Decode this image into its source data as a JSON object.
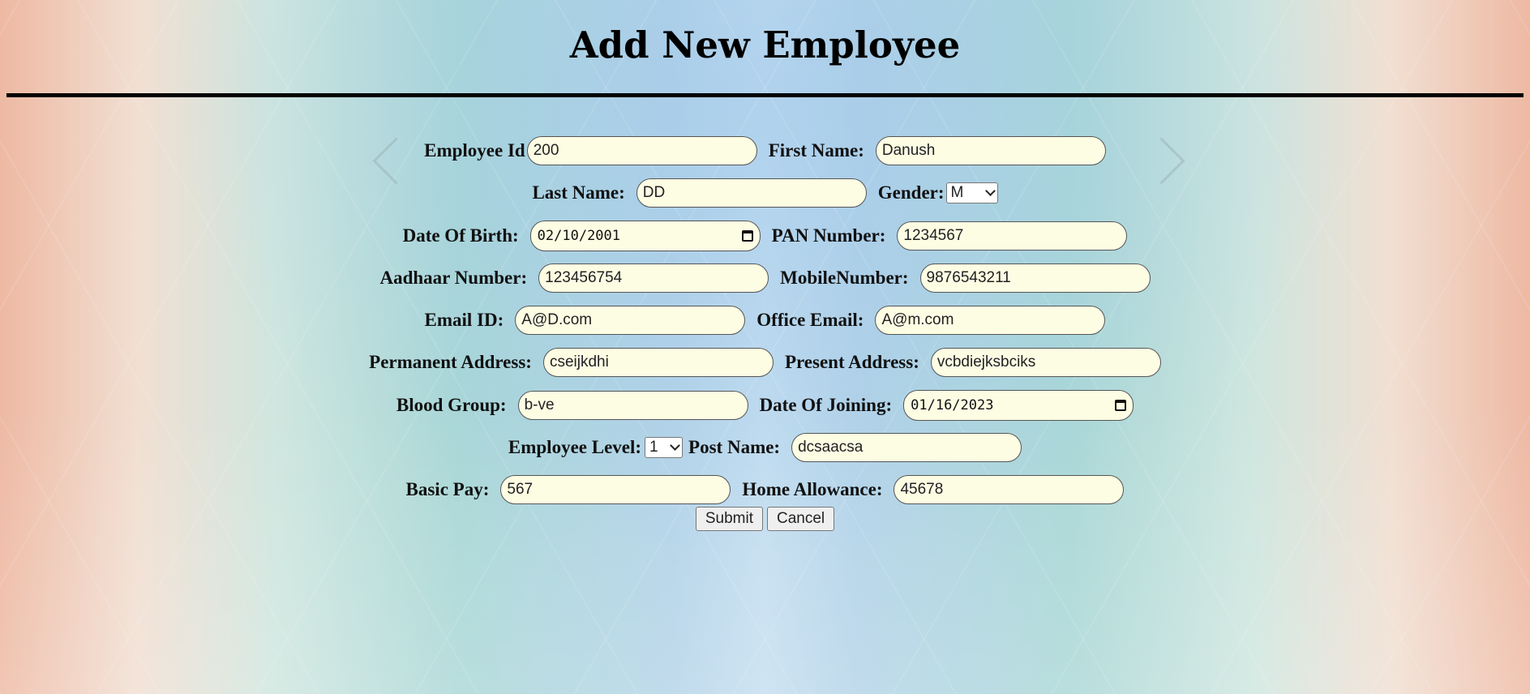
{
  "page": {
    "title": "Add New Employee"
  },
  "form": {
    "employee_id": {
      "label": "Employee Id",
      "value": "200"
    },
    "first_name": {
      "label": "First Name:",
      "value": "Danush"
    },
    "last_name": {
      "label": "Last Name:",
      "value": "DD"
    },
    "gender": {
      "label": "Gender:",
      "value": "M"
    },
    "dob": {
      "label": "Date Of Birth:",
      "value": "02/10/2001"
    },
    "pan": {
      "label": "PAN Number:",
      "value": "1234567"
    },
    "aadhaar": {
      "label": "Aadhaar Number:",
      "value": "123456754"
    },
    "mobile": {
      "label": "MobileNumber:",
      "value": "9876543211"
    },
    "email": {
      "label": "Email ID:",
      "value": "A@D.com"
    },
    "office_email": {
      "label": "Office Email:",
      "value": "A@m.com"
    },
    "permanent_address": {
      "label": "Permanent Address:",
      "value": "cseijkdhi"
    },
    "present_address": {
      "label": "Present Address:",
      "value": "vcbdiejksbciks"
    },
    "blood_group": {
      "label": "Blood Group:",
      "value": "b-ve"
    },
    "doj": {
      "label": "Date Of Joining:",
      "value": "01/16/2023"
    },
    "employee_level": {
      "label": "Employee Level:",
      "value": "1"
    },
    "post_name": {
      "label": "Post Name:",
      "value": "dcsaacsa"
    },
    "basic_pay": {
      "label": "Basic Pay:",
      "value": "567"
    },
    "home_allowance": {
      "label": "Home Allowance:",
      "value": "45678"
    }
  },
  "buttons": {
    "submit": "Submit",
    "cancel": "Cancel"
  },
  "icons": {
    "date_picker": "calendar-icon",
    "dropdown": "chevron-down-icon"
  }
}
